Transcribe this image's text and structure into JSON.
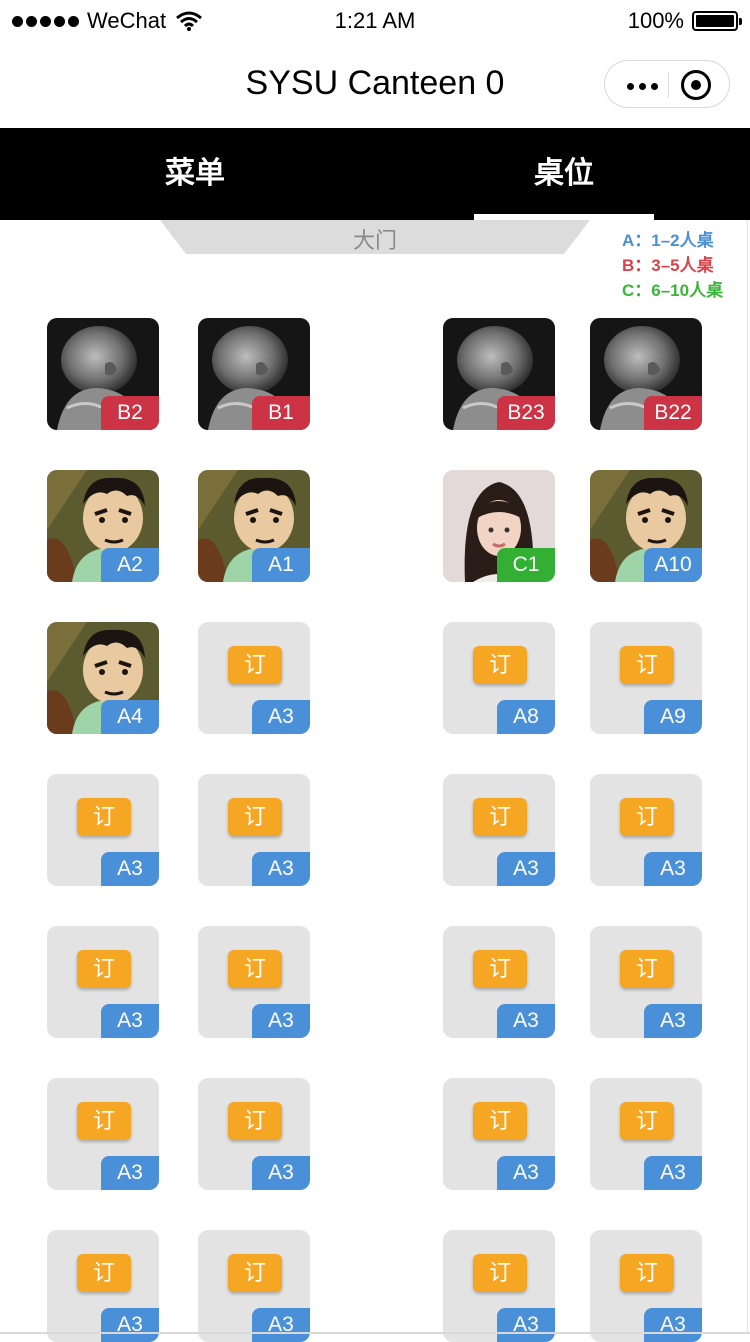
{
  "status_bar": {
    "carrier": "WeChat",
    "time": "1:21 AM",
    "battery": "100%"
  },
  "nav": {
    "title": "SYSU Canteen 0"
  },
  "tabs": [
    {
      "label": "菜单",
      "active": false
    },
    {
      "label": "桌位",
      "active": true
    }
  ],
  "door_label": "大门",
  "legend": [
    {
      "text": "A：1–2人桌",
      "color": "#4a90d9"
    },
    {
      "text": "B：3–5人桌",
      "color": "#d8434a"
    },
    {
      "text": "C：6–10人桌",
      "color": "#3ab53a"
    }
  ],
  "book_label": "订",
  "tables": [
    {
      "label": "B2",
      "type": "B",
      "occupant": "bald-man-photo"
    },
    {
      "label": "B1",
      "type": "B",
      "occupant": "bald-man-photo"
    },
    {
      "label": "B23",
      "type": "B",
      "occupant": "bald-man-photo"
    },
    {
      "label": "B22",
      "type": "B",
      "occupant": "bald-man-photo"
    },
    {
      "label": "A2",
      "type": "A",
      "occupant": "cartoon-man"
    },
    {
      "label": "A1",
      "type": "A",
      "occupant": "cartoon-man"
    },
    {
      "label": "C1",
      "type": "C",
      "occupant": "woman-photo"
    },
    {
      "label": "A10",
      "type": "A",
      "occupant": "cartoon-man"
    },
    {
      "label": "A4",
      "type": "A",
      "occupant": "cartoon-man"
    },
    {
      "label": "A3",
      "type": "A",
      "occupant": null
    },
    {
      "label": "A8",
      "type": "A",
      "occupant": null
    },
    {
      "label": "A9",
      "type": "A",
      "occupant": null
    },
    {
      "label": "A3",
      "type": "A",
      "occupant": null
    },
    {
      "label": "A3",
      "type": "A",
      "occupant": null
    },
    {
      "label": "A3",
      "type": "A",
      "occupant": null
    },
    {
      "label": "A3",
      "type": "A",
      "occupant": null
    },
    {
      "label": "A3",
      "type": "A",
      "occupant": null
    },
    {
      "label": "A3",
      "type": "A",
      "occupant": null
    },
    {
      "label": "A3",
      "type": "A",
      "occupant": null
    },
    {
      "label": "A3",
      "type": "A",
      "occupant": null
    },
    {
      "label": "A3",
      "type": "A",
      "occupant": null
    },
    {
      "label": "A3",
      "type": "A",
      "occupant": null
    },
    {
      "label": "A3",
      "type": "A",
      "occupant": null
    },
    {
      "label": "A3",
      "type": "A",
      "occupant": null
    },
    {
      "label": "A3",
      "type": "A",
      "occupant": null
    },
    {
      "label": "A3",
      "type": "A",
      "occupant": null
    },
    {
      "label": "A3",
      "type": "A",
      "occupant": null
    },
    {
      "label": "A3",
      "type": "A",
      "occupant": null
    }
  ]
}
